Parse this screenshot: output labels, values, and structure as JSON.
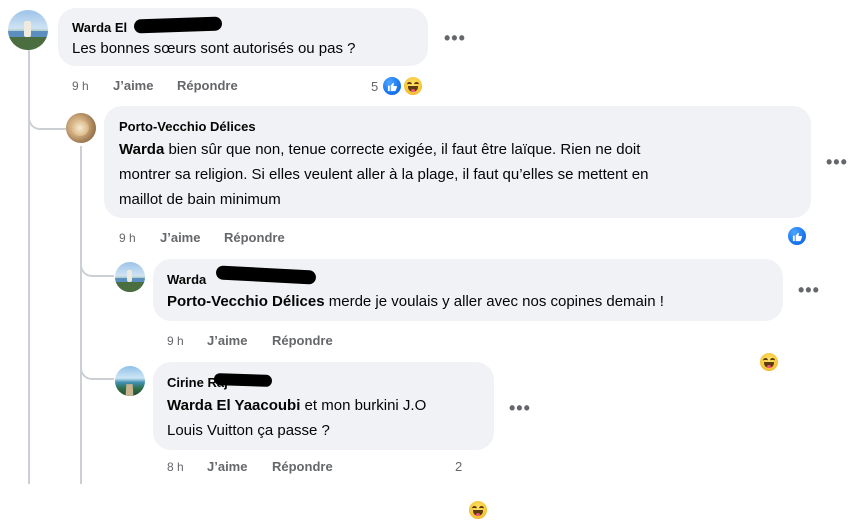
{
  "comments": [
    {
      "name": "Warda El",
      "text": "Les bonnes sœurs sont autorisés ou pas ?",
      "time": "9 h",
      "like_label": "J’aime",
      "reply_label": "Répondre",
      "reaction_count": "5",
      "reactions": [
        "like-icon",
        "haha-icon"
      ]
    },
    {
      "name": "Porto-Vecchio Délices",
      "mention": "Warda",
      "text_line1": " bien sûr que non, tenue correcte exigée, il faut être laïque. Rien ne doit",
      "text_line2": "montrer sa religion. Si elles veulent aller à la plage, il faut qu’elles se mettent en",
      "text_line3": "maillot de bain minimum",
      "time": "9 h",
      "like_label": "J’aime",
      "reply_label": "Répondre",
      "reactions": [
        "like-icon"
      ]
    },
    {
      "name": "Warda",
      "mention": "Porto-Vecchio Délices",
      "text": " merde je voulais y aller avec nos copines demain !",
      "time": "9 h",
      "like_label": "J’aime",
      "reply_label": "Répondre",
      "reactions": [
        "haha-icon"
      ]
    },
    {
      "name": "Cirine Raj",
      "mention": "Warda El Yaacoubi",
      "text_line1": " et mon burkini J.O",
      "text_line2": "Louis Vuitton ça passe ?",
      "time": "8 h",
      "like_label": "J’aime",
      "reply_label": "Répondre",
      "reaction_count": "2",
      "reactions": [
        "haha-icon"
      ]
    }
  ],
  "more_options_label": "•••",
  "colors": {
    "bubble": "#f0f2f5",
    "meta": "#65676b",
    "like_blue": "#1877f2",
    "haha_yellow": "#f7c93d"
  }
}
